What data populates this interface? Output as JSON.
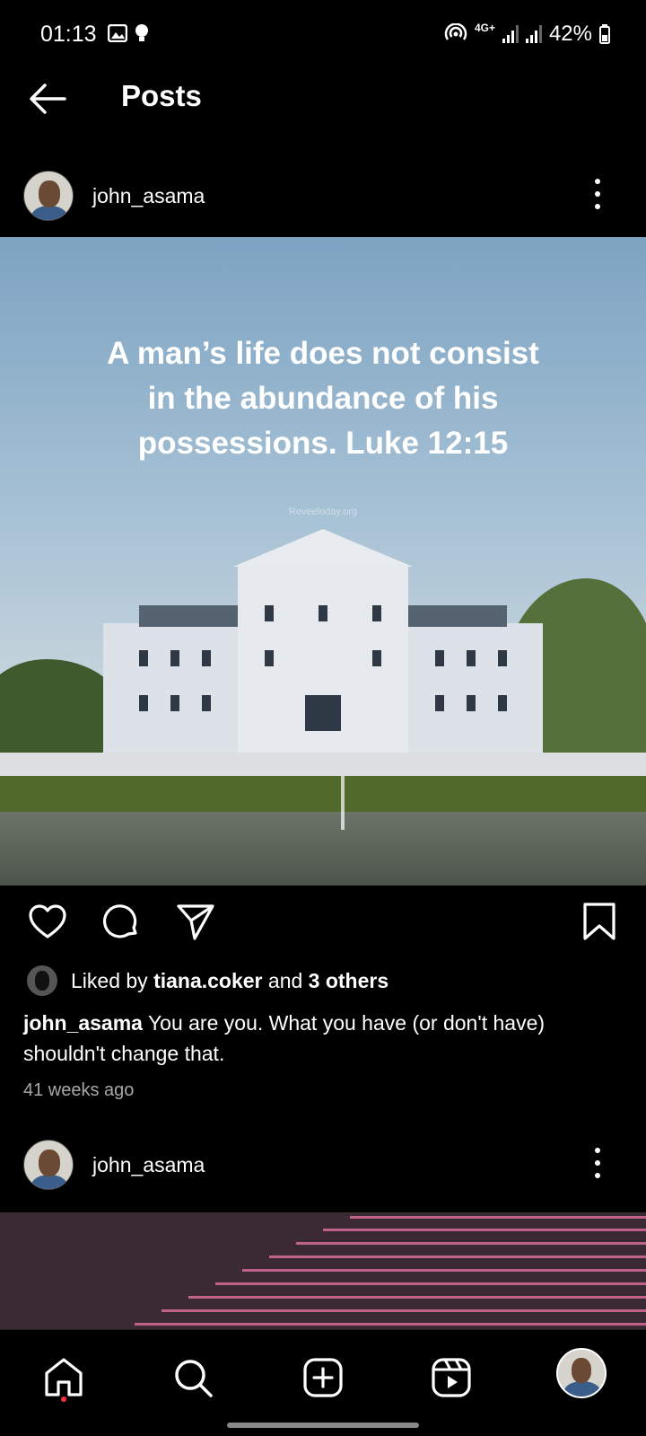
{
  "status_bar": {
    "time": "01:13",
    "network": "4G+",
    "battery": "42%"
  },
  "app_bar": {
    "title": "Posts"
  },
  "posts": [
    {
      "username": "john_asama",
      "image_quote": "A man’s life does not consist in the abundance of his possessions. Luke 12:15",
      "image_watermark": "Reveeloday.org",
      "liked_by_prefix": "Liked by",
      "liked_by_user": "tiana.coker",
      "liked_by_middle": "and",
      "liked_by_others": "3 others",
      "caption_user": "john_asama",
      "caption_text": "You are you. What you have (or don't have) shouldn't change that.",
      "time_ago": "41 weeks ago"
    },
    {
      "username": "john_asama"
    }
  ],
  "icons": {
    "back": "arrow-left-icon",
    "more": "more-vertical-icon",
    "like": "heart-icon",
    "comment": "comment-icon",
    "share": "send-icon",
    "save": "bookmark-icon",
    "nav": [
      "home-icon",
      "search-icon",
      "create-icon",
      "reels-icon",
      "profile-avatar"
    ]
  },
  "colors": {
    "background": "#000000",
    "notification_dot": "#ff3040",
    "secondary_text": "#a8a8a8"
  }
}
